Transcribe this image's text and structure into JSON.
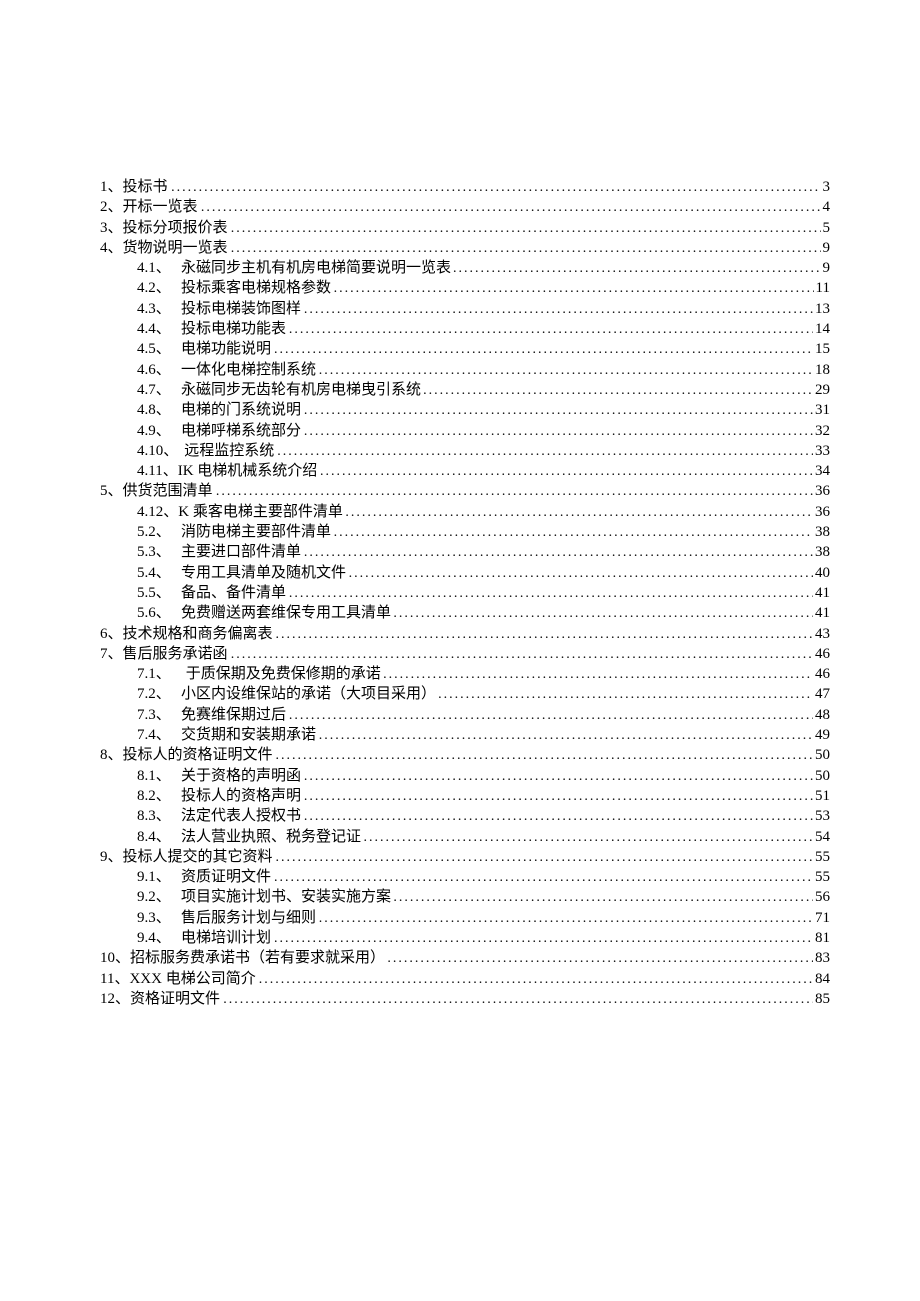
{
  "toc": [
    {
      "level": 1,
      "num": "1、",
      "title": "投标书",
      "page": "3"
    },
    {
      "level": 1,
      "num": "2、",
      "title": "开标一览表",
      "page": "4"
    },
    {
      "level": 1,
      "num": "3、",
      "title": "投标分项报价表",
      "page": "5"
    },
    {
      "level": 1,
      "num": "4、",
      "title": "货物说明一览表",
      "page": "9"
    },
    {
      "level": 2,
      "num": "4.1、",
      "title": "永磁同步主机有机房电梯简要说明一览表",
      "page": "9"
    },
    {
      "level": 2,
      "num": "4.2、",
      "title": "投标乘客电梯规格参数",
      "page": "11"
    },
    {
      "level": 2,
      "num": "4.3、",
      "title": "投标电梯装饰图样",
      "page": "13"
    },
    {
      "level": 2,
      "num": "4.4、",
      "title": "投标电梯功能表",
      "page": "14"
    },
    {
      "level": 2,
      "num": "4.5、",
      "title": "电梯功能说明",
      "page": "15"
    },
    {
      "level": 2,
      "num": "4.6、",
      "title": "一体化电梯控制系统",
      "page": "18"
    },
    {
      "level": 2,
      "num": "4.7、",
      "title": "永磁同步无齿轮有机房电梯曳引系统",
      "page": "29"
    },
    {
      "level": 2,
      "num": "4.8、",
      "title": "电梯的门系统说明",
      "page": "31"
    },
    {
      "level": 2,
      "num": "4.9、",
      "title": "电梯呼梯系统部分",
      "page": "32"
    },
    {
      "level": 2,
      "num": "4.10、",
      "title": "远程监控系统",
      "page": "33"
    },
    {
      "level": 2,
      "num": "4.11、",
      "title": "IK 电梯机械系统介绍",
      "page": "34",
      "tight": true
    },
    {
      "level": 1,
      "num": "5、",
      "title": "供货范围清单",
      "page": "36"
    },
    {
      "level": 2,
      "num": "4.12、",
      "title": "K 乘客电梯主要部件清单",
      "page": "36",
      "tight": true
    },
    {
      "level": 2,
      "num": "5.2、",
      "title": "消防电梯主要部件清单",
      "page": "38"
    },
    {
      "level": 2,
      "num": "5.3、",
      "title": "主要进口部件清单",
      "page": "38"
    },
    {
      "level": 2,
      "num": "5.4、",
      "title": "专用工具清单及随机文件",
      "page": "40"
    },
    {
      "level": 2,
      "num": "5.5、",
      "title": "备品、备件清单",
      "page": "41"
    },
    {
      "level": 2,
      "num": "5.6、",
      "title": "免费赠送两套维保专用工具清单",
      "page": "41"
    },
    {
      "level": 1,
      "num": "6、",
      "title": "技术规格和商务偏离表",
      "page": "43"
    },
    {
      "level": 1,
      "num": "7、",
      "title": "售后服务承诺函",
      "page": "46"
    },
    {
      "level": 2,
      "num": "7.1、",
      "title": "　于质保期及免费保修期的承诺",
      "page": "46",
      "tight": true
    },
    {
      "level": 2,
      "num": "7.2、",
      "title": "小区内设维保站的承诺（大项目采用）",
      "page": "47"
    },
    {
      "level": 2,
      "num": "7.3、",
      "title": "免赛维保期过后",
      "page": "48"
    },
    {
      "level": 2,
      "num": "7.4、",
      "title": "交货期和安装期承诺",
      "page": "49"
    },
    {
      "level": 1,
      "num": "8、",
      "title": "投标人的资格证明文件",
      "page": "50"
    },
    {
      "level": 2,
      "num": "8.1、",
      "title": "关于资格的声明函",
      "page": "50"
    },
    {
      "level": 2,
      "num": "8.2、",
      "title": "投标人的资格声明",
      "page": "51"
    },
    {
      "level": 2,
      "num": "8.3、",
      "title": "法定代表人授权书",
      "page": "53"
    },
    {
      "level": 2,
      "num": "8.4、",
      "title": "法人营业执照、税务登记证",
      "page": "54"
    },
    {
      "level": 1,
      "num": "9、",
      "title": "投标人提交的其它资料",
      "page": "55"
    },
    {
      "level": 2,
      "num": "9.1、",
      "title": "资质证明文件",
      "page": "55"
    },
    {
      "level": 2,
      "num": "9.2、",
      "title": "项目实施计划书、安装实施方案",
      "page": "56"
    },
    {
      "level": 2,
      "num": "9.3、",
      "title": "售后服务计划与细则",
      "page": "71"
    },
    {
      "level": 2,
      "num": "9.4、",
      "title": "电梯培训计划",
      "page": "81"
    },
    {
      "level": 1,
      "num": "10、",
      "title": "招标服务费承诺书（若有要求就采用）",
      "page": "83"
    },
    {
      "level": 1,
      "num": "11、",
      "title": "XXX 电梯公司简介",
      "page": "84"
    },
    {
      "level": 1,
      "num": "12、",
      "title": "资格证明文件",
      "page": "85"
    }
  ]
}
